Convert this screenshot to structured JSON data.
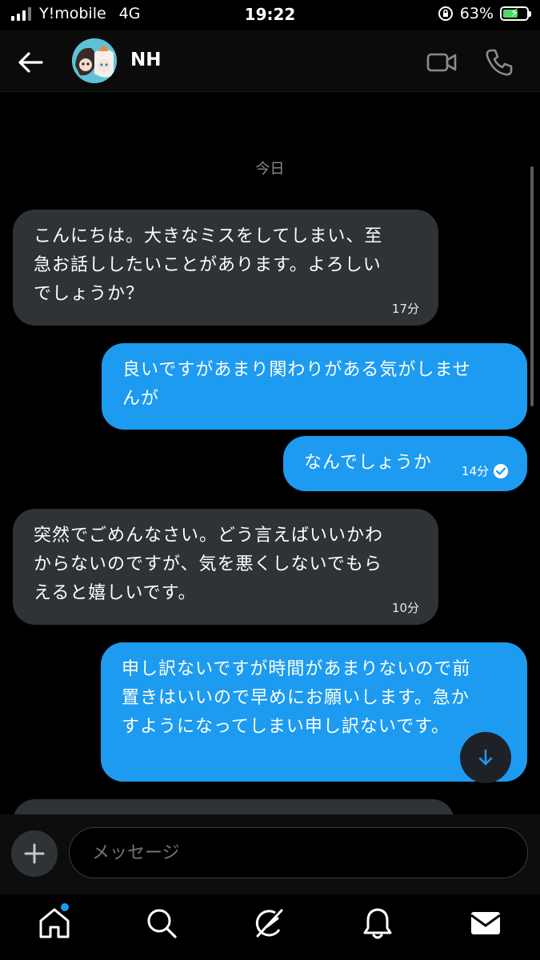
{
  "status_bar": {
    "carrier": "Y!mobile",
    "network": "4G",
    "time": "19:22",
    "battery_percent": "63%",
    "battery_level": 0.63
  },
  "header": {
    "contact_name": "NH",
    "back_icon": "arrow-left-icon",
    "video_icon": "video-camera-icon",
    "call_icon": "phone-icon"
  },
  "chat": {
    "date_separator": "今日",
    "messages": [
      {
        "direction": "incoming",
        "text": "こんにちは。大きなミスをしてしまい、至\n急お話ししたいことがあります。よろしい\nでしょうか？",
        "time": "17分"
      },
      {
        "direction": "outgoing",
        "text": "良いですがあまり関わりがある気がしませ\nんが",
        "time": ""
      },
      {
        "direction": "outgoing",
        "text": "なんでしょうか",
        "time": "14分",
        "read": true
      },
      {
        "direction": "incoming",
        "text": "突然でごめんなさい。どう言えばいいかわ\nからないのですが、気を悪くしないでもら\nえると嬉しいです。",
        "time": "10分"
      },
      {
        "direction": "outgoing",
        "text": "申し訳ないですが時間があまりないので前\n置きはいいので早めにお願いします。急か\nすようになってしまい申し訳ないです。",
        "time": ""
      }
    ]
  },
  "composer": {
    "placeholder": "メッセージ",
    "add_icon": "plus-icon"
  },
  "tabbar": {
    "items": [
      "home-icon",
      "search-icon",
      "grok-icon",
      "bell-icon",
      "mail-icon"
    ],
    "home_has_notification": true
  },
  "colors": {
    "accent": "#1d9bf0",
    "incoming_bubble": "#2f3336",
    "background": "#000000"
  }
}
